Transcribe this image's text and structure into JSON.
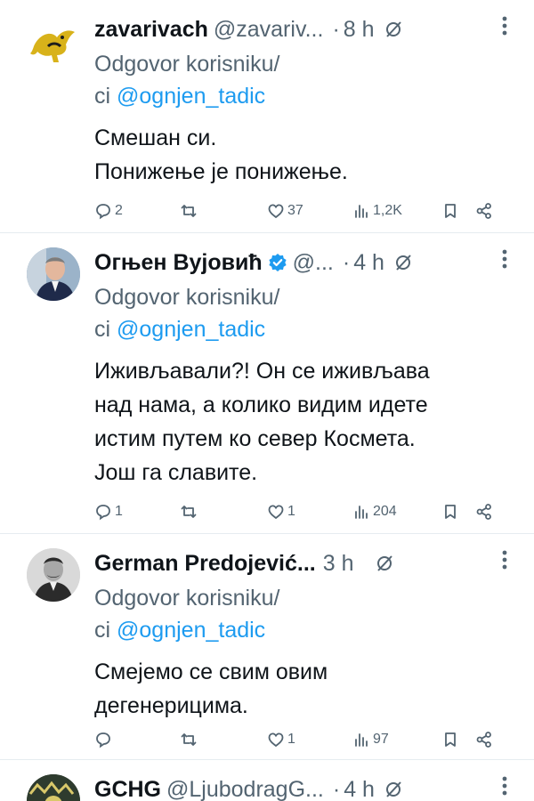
{
  "reply_prefix": "Odgovor korisniku/",
  "reply_prefix2": "ci",
  "colors": {
    "text": "#0f1419",
    "muted": "#536471",
    "link": "#1d9bf0",
    "verified": "#1d9bf0"
  },
  "tweets": [
    {
      "name": "zavarivach",
      "handle": "@zavariv...",
      "time": "8 h",
      "mention": "@ognjen_tadic",
      "lines": [
        "Смешан си.",
        "Понижење је понижење."
      ],
      "replies": "2",
      "retweets": "",
      "likes": "37",
      "views": "1,2K"
    },
    {
      "name": "Огњен Вујовић",
      "handle": "@...",
      "time": "4 h",
      "verified": true,
      "mention": "@ognjen_tadic",
      "lines": [
        "Иживљавали?! Он се иживљава",
        "над нама, а колико видим идете",
        "истим путем ко север Космета.",
        "Још га славите."
      ],
      "replies": "1",
      "retweets": "",
      "likes": "1",
      "views": "204"
    },
    {
      "name": "German Predojević...",
      "handle": "",
      "time": "3 h",
      "mention": "@ognjen_tadic",
      "lines": [
        "Смејемо се свим овим",
        "дегенерицима."
      ],
      "replies": "",
      "retweets": "",
      "likes": "1",
      "views": "97"
    },
    {
      "name": "GCHG",
      "handle": "@LjubodragG...",
      "time": "4 h"
    }
  ]
}
